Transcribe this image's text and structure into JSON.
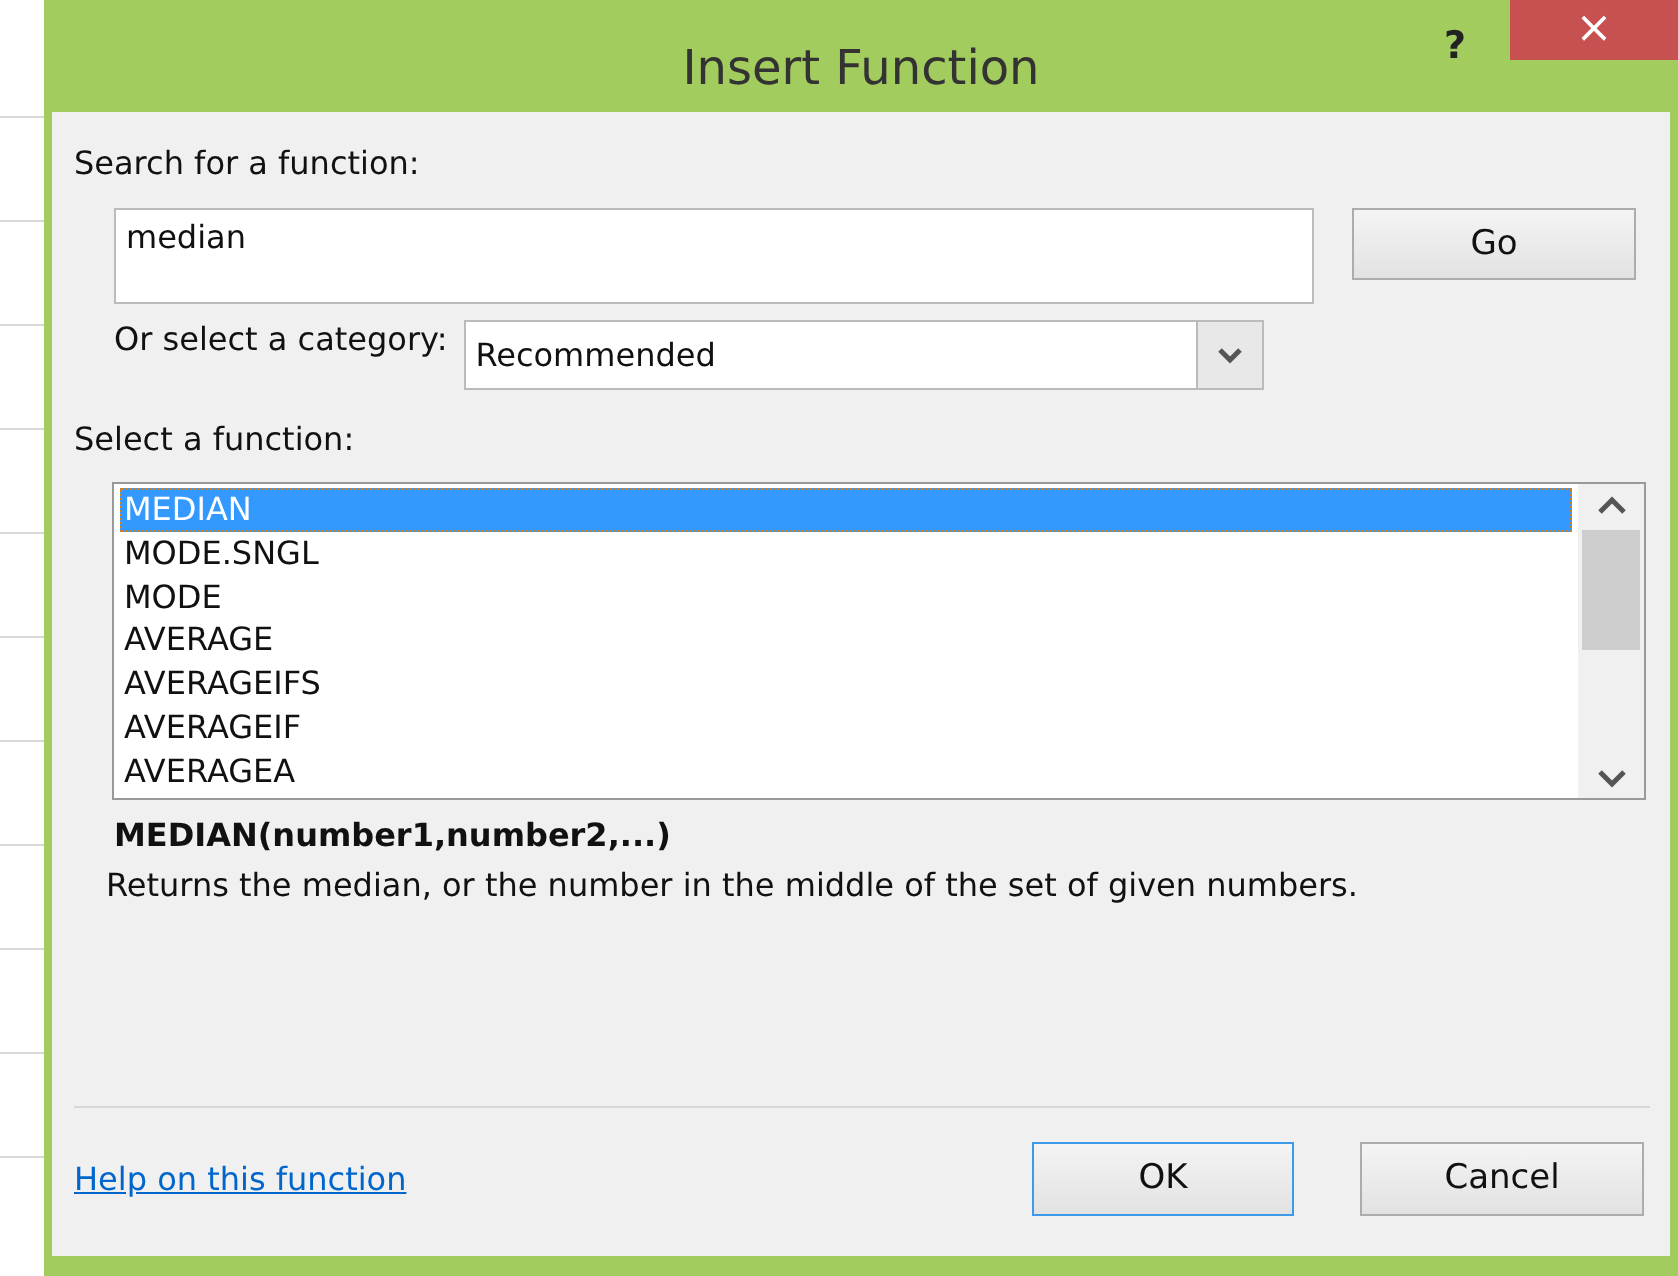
{
  "window": {
    "title": "Insert Function",
    "help_button": "?",
    "close_button": "×"
  },
  "search": {
    "label": "Search for a function:",
    "value": "median",
    "go_button": "Go"
  },
  "category": {
    "label": "Or select a category:",
    "value": "Recommended"
  },
  "functions": {
    "label": "Select a function:",
    "items": [
      {
        "name": "MEDIAN",
        "selected": true
      },
      {
        "name": "MODE.SNGL",
        "selected": false
      },
      {
        "name": "MODE",
        "selected": false
      },
      {
        "name": "AVERAGE",
        "selected": false
      },
      {
        "name": "AVERAGEIFS",
        "selected": false
      },
      {
        "name": "AVERAGEIF",
        "selected": false
      },
      {
        "name": "AVERAGEA",
        "selected": false
      }
    ]
  },
  "signature": "MEDIAN(number1,number2,...)",
  "description": "Returns the median, or the number in the middle of the set of given numbers.",
  "help_link": "Help on this function",
  "buttons": [
    "OK",
    "Cancel"
  ]
}
